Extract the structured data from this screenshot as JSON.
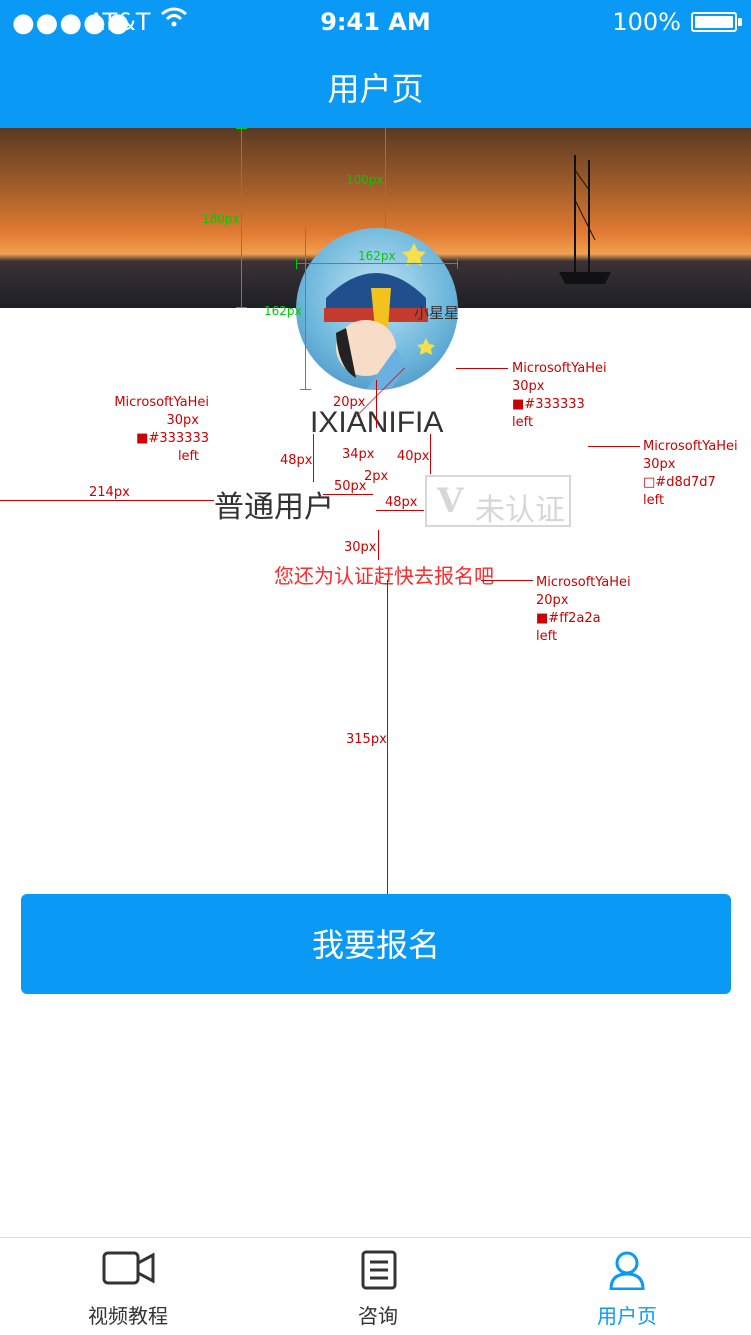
{
  "status": {
    "signal": "●●●●●",
    "carrier": "AT&T",
    "wifi": "◠",
    "time": "9:41 AM",
    "battery": "100%"
  },
  "nav": {
    "title": "用户页"
  },
  "avatar": {
    "watermark": "小星星"
  },
  "profile": {
    "username": "IXIANIFIA",
    "usertype": "普通用户",
    "badge_icon": "V",
    "badge_text": "未认证",
    "notice": "您还为认证赶快去报名吧"
  },
  "button": {
    "label": "我要报名"
  },
  "tabs": [
    {
      "label": "视频教程",
      "icon": "video-camera-icon"
    },
    {
      "label": "咨询",
      "icon": "document-list-icon"
    },
    {
      "label": "用户页",
      "icon": "user-icon"
    }
  ],
  "annotations": {
    "h180": "180px",
    "h100": "100px",
    "w162": "162px",
    "h162": "162px",
    "a_username": {
      "font": "MicrosoftYaHei",
      "size": "30px",
      "color": "#333333",
      "align": "left"
    },
    "a_usertype": {
      "font": "MicrosoftYaHei",
      "size": "30px",
      "color": "#333333",
      "align": "left"
    },
    "a_badge": {
      "font": "MicrosoftYaHei",
      "size": "30px",
      "color": "#d8d7d7",
      "align": "left"
    },
    "a_notice": {
      "font": "MicrosoftYaHei",
      "size": "20px",
      "color": "#ff2a2a",
      "align": "left"
    },
    "d20": "20px",
    "d48a": "48px",
    "d34": "34px",
    "d40": "40px",
    "d2": "2px",
    "d50": "50px",
    "d48b": "48px",
    "d214": "214px",
    "d30": "30px",
    "d315": "315px"
  },
  "colors": {
    "brand": "#0a9af5",
    "text": "#333333",
    "muted": "#d8d7d7",
    "alert": "#ff2a2a"
  }
}
